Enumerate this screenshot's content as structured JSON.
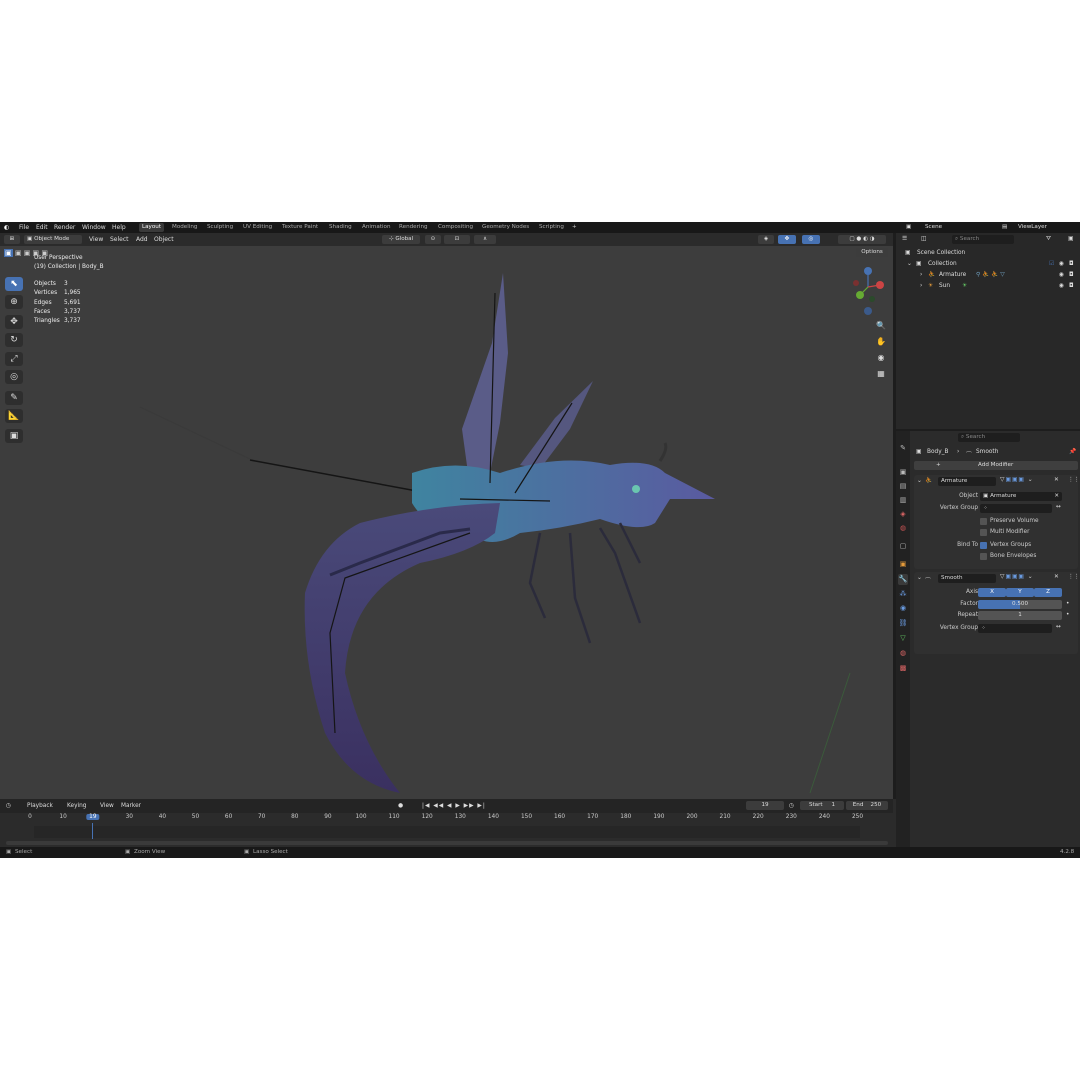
{
  "menu": [
    "File",
    "Edit",
    "Render",
    "Window",
    "Help"
  ],
  "workspaces": [
    "Layout",
    "Modeling",
    "Sculpting",
    "UV Editing",
    "Texture Paint",
    "Shading",
    "Animation",
    "Rendering",
    "Compositing",
    "Geometry Nodes",
    "Scripting"
  ],
  "scene": "Scene",
  "view_layer": "ViewLayer",
  "viewport": {
    "mode": "Object Mode",
    "view": "View",
    "select": "Select",
    "add": "Add",
    "object": "Object",
    "orientation": "Global",
    "options": "Options",
    "view_title": "User Perspective",
    "view_sub": "(19) Collection | Body_B",
    "stats": [
      {
        "k": "Objects",
        "v": "3"
      },
      {
        "k": "Vertices",
        "v": "1,965"
      },
      {
        "k": "Edges",
        "v": "5,691"
      },
      {
        "k": "Faces",
        "v": "3,737"
      },
      {
        "k": "Triangles",
        "v": "3,737"
      }
    ]
  },
  "timeline": {
    "playback": "Playback",
    "keying": "Keying",
    "view": "View",
    "marker": "Marker",
    "current": "19",
    "start_label": "Start",
    "start": "1",
    "end_label": "End",
    "end": "250",
    "frames": [
      "0",
      "10",
      "19",
      "30",
      "40",
      "50",
      "60",
      "70",
      "80",
      "90",
      "100",
      "110",
      "120",
      "130",
      "140",
      "150",
      "160",
      "170",
      "180",
      "190",
      "200",
      "210",
      "220",
      "230",
      "240",
      "250"
    ]
  },
  "status": {
    "select": "Select",
    "zoom": "Zoom View",
    "lasso": "Lasso Select",
    "version": "4.2.8"
  },
  "outliner": {
    "search": "Search",
    "root": "Scene Collection",
    "collection": "Collection",
    "items": [
      "Armature",
      "Sun"
    ]
  },
  "properties": {
    "search": "Search",
    "object": "Body_B",
    "modifier": "Smooth",
    "add_modifier": "Add Modifier",
    "armature_mod": {
      "name": "Armature",
      "object_label": "Object",
      "object": "Armature",
      "vgroup_label": "Vertex Group",
      "preserve": "Preserve Volume",
      "multi": "Multi Modifier",
      "bind_label": "Bind To",
      "vgroups": "Vertex Groups",
      "envelopes": "Bone Envelopes"
    },
    "smooth_mod": {
      "name": "Smooth",
      "axis_label": "Axis",
      "x": "X",
      "y": "Y",
      "z": "Z",
      "factor_label": "Factor",
      "factor": "0.500",
      "repeat_label": "Repeat",
      "repeat": "1",
      "vgroup_label": "Vertex Group"
    }
  },
  "colors": {
    "accent": "#4772b3",
    "bg": "#3d3d3d"
  }
}
